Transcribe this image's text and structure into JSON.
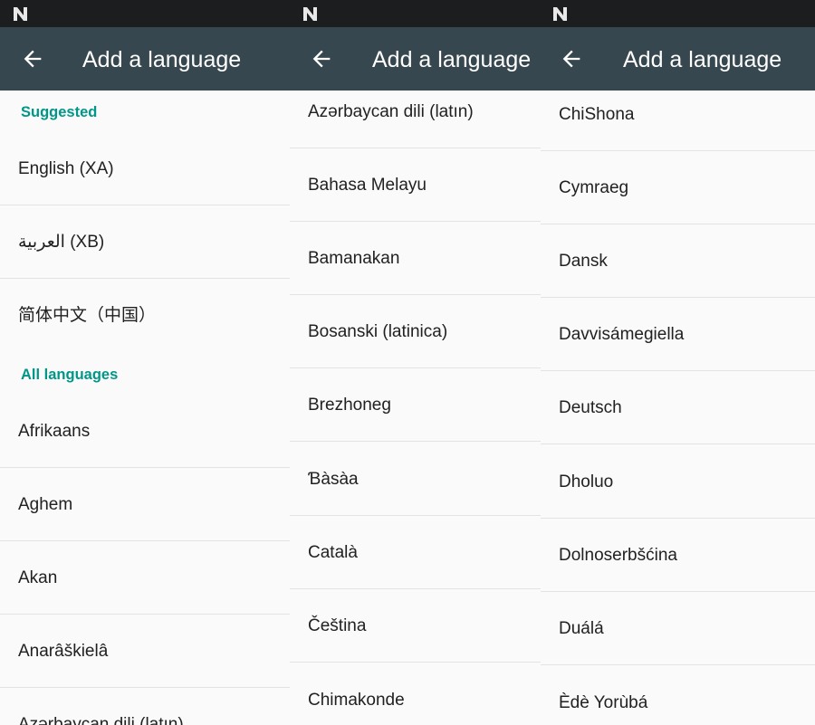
{
  "panels": [
    {
      "title": "Add a language",
      "sections": {
        "suggested_header": "Suggested",
        "all_header": "All languages"
      },
      "suggested": [
        "English (XA)",
        "العربية (XB)",
        "简体中文（中国）"
      ],
      "items": [
        "Afrikaans",
        "Aghem",
        "Akan",
        "Anarâškielâ",
        "Azərbaycan dili (latın)"
      ]
    },
    {
      "title": "Add a language",
      "items": [
        "Azərbaycan dili (latın)",
        "Bahasa Melayu",
        "Bamanakan",
        "Bosanski (latinica)",
        "Brezhoneg",
        "Ɓàsàa",
        "Català",
        "Čeština",
        "Chimakonde"
      ]
    },
    {
      "title": "Add a language",
      "items": [
        "ChiShona",
        "Cymraeg",
        "Dansk",
        "Davvisámegiella",
        "Deutsch",
        "Dholuo",
        "Dolnoserbšćina",
        "Duálá",
        "Èdè Yorùbá"
      ]
    }
  ],
  "colors": {
    "status_bar": "#1b1d1f",
    "app_bar": "#37474f",
    "accent": "#009688",
    "background": "#fafafa",
    "divider": "#e3e3e3"
  },
  "icons": {
    "status": "android-n-icon",
    "back": "arrow-back-icon"
  }
}
